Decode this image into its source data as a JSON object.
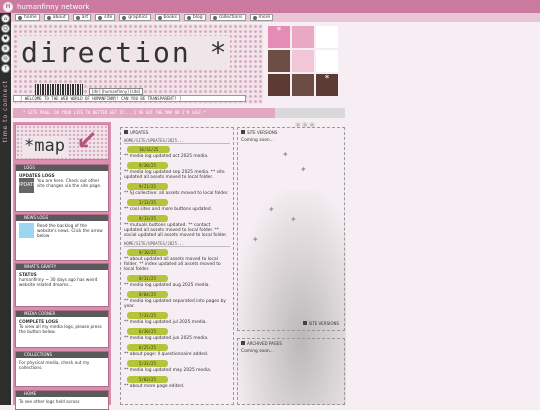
{
  "site": {
    "name": "humanfinny network"
  },
  "nav": [
    {
      "label": "home"
    },
    {
      "label": "about"
    },
    {
      "label": "art"
    },
    {
      "label": "site"
    },
    {
      "label": "graphics"
    },
    {
      "label": "books"
    },
    {
      "label": "blog"
    },
    {
      "label": "collections"
    },
    {
      "label": "more"
    }
  ],
  "rail": {
    "buttons": [
      "1",
      "2",
      "3",
      "4",
      "5",
      "6"
    ],
    "vertical_text": "time to connect"
  },
  "header": {
    "title": "direction *",
    "barcode_label": "[dir] [humanfinny] [site]",
    "welcome": "[ WELCOME TO THE WEB WORLD OF HUMANFINNY! CAN YOU BE TRANSPARENT? ]"
  },
  "tiles": [
    {
      "color": "#e48cb5",
      "mark": "*"
    },
    {
      "color": "#e9a8c3",
      "mark": ""
    },
    {
      "color": "#ffffff",
      "mark": ""
    },
    {
      "color": "#6e4d45",
      "mark": ""
    },
    {
      "color": "#f1c7d8",
      "mark": ""
    },
    {
      "color": "#ffffff",
      "mark": ""
    },
    {
      "color": "#5d3a33",
      "mark": ""
    },
    {
      "color": "#6c4c44",
      "mark": ""
    },
    {
      "color": "#5c3b34",
      "mark": "*"
    }
  ],
  "strip": {
    "text": "* SITE PAGE: DO YOUR LIFE TO BETTER GET IT... I'VE GOT THE MAP OR I'M LOST *"
  },
  "sidebar": {
    "map_title": "*map",
    "sections": [
      {
        "id": "logs",
        "heading": "LOGS",
        "sub": "UPDATES LOGS",
        "text": "You are here. Check out other site changes via the site page.",
        "icon_label": "UPDATE",
        "icon_color": "#666666"
      },
      {
        "id": "news",
        "heading": "NEWS LOGS",
        "sub": "",
        "text": "Read the backlog of the website's news. Click the arrow below",
        "icon_label": "",
        "icon_color": "#9dd6f0"
      },
      {
        "id": "status",
        "heading": "WHAT'S GRAFFY",
        "sub": "STATUS",
        "text": "humanfinny ~ 30 days ago has weird website related dreams...",
        "icon_label": "",
        "icon_color": ""
      },
      {
        "id": "media",
        "heading": "MEDIA CORNER",
        "sub": "COMPLETE LOGS",
        "text": "To view all my media logs, please press the button below.",
        "icon_label": "",
        "icon_color": ""
      },
      {
        "id": "collections",
        "heading": "COLLECTIONS",
        "sub": "",
        "text": "For physical media, check out my collections.",
        "icon_label": "",
        "icon_color": ""
      },
      {
        "id": "home",
        "heading": "HOME",
        "sub": "",
        "text": "To see other logs held across",
        "icon_label": "",
        "icon_color": ""
      }
    ]
  },
  "updates": {
    "heading": "UPDATES",
    "path1": "HOME/SITE/UPDATES/2025...",
    "entries1": [
      {
        "date": "10/31/25",
        "text": "** media log updated oct 2025 media."
      },
      {
        "date": "9/30/25",
        "text": "** media log updated sep 2025 media. ** site updated all assets moved to local folder."
      },
      {
        "date": "9/21/25",
        "text": "** SJ collective: all assets moved to local folder."
      },
      {
        "date": "2/13/25",
        "text": "** cool sites and more buttons updated."
      },
      {
        "date": "9/13/25",
        "text": "** mutuals buttons updated. ** contact updated all assets moved to local folder. ** social updated all assets moved to local folder."
      }
    ],
    "path2": "HOME/SITE/UPDATES/2025...",
    "entries2": [
      {
        "date": "9/10/25",
        "text": "** about updated all assets moved to local folder. ** index updated all assets moved to local folder."
      },
      {
        "date": "8/31/25",
        "text": "** media log updated aug 2025 media."
      },
      {
        "date": "8/04/25",
        "text": "** media log updated separated into pages by year."
      },
      {
        "date": "7/31/25",
        "text": "** media log updated jul 2025 media."
      },
      {
        "date": "6/30/25",
        "text": "** media log updated jun 2025 media."
      },
      {
        "date": "6/25/25",
        "text": "** about page: ll questionnaire added."
      },
      {
        "date": "5/31/25",
        "text": "** media log updated may 2025 media."
      },
      {
        "date": "5/03/25",
        "text": "** about more page edited."
      }
    ]
  },
  "col3": {
    "heading": "SITE VERSIONS",
    "body": "Coming soon...",
    "footer": "SITE VERSIONS",
    "stars": "***"
  },
  "col3b": {
    "heading": "ARCHIVED PAGES",
    "body": "Coming soon..."
  }
}
